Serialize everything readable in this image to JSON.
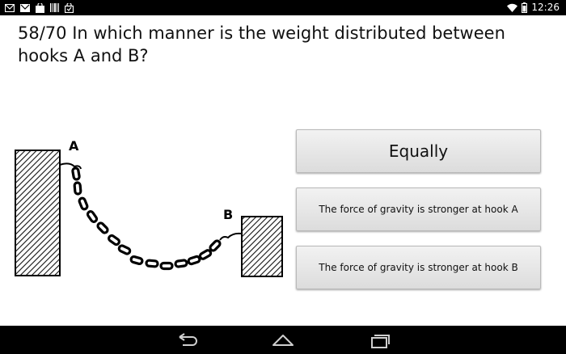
{
  "status_bar": {
    "time": "12:26",
    "left_icons": [
      "mail-icon",
      "email-icon",
      "bag-icon",
      "barcode-icon",
      "shopping-bag-icon"
    ],
    "right_icons": [
      "wifi-icon",
      "battery-icon"
    ]
  },
  "question": {
    "text": "58/70 In which manner is the weight distributed between hooks A and B?"
  },
  "figure": {
    "hook_a_label": "A",
    "hook_b_label": "B"
  },
  "answers": [
    {
      "label": "Equally"
    },
    {
      "label": "The force of gravity is stronger at hook A"
    },
    {
      "label": "The force of gravity is stronger at hook B"
    }
  ],
  "nav_bar": {
    "icons": [
      "back-icon",
      "home-icon",
      "recent-apps-icon"
    ]
  }
}
